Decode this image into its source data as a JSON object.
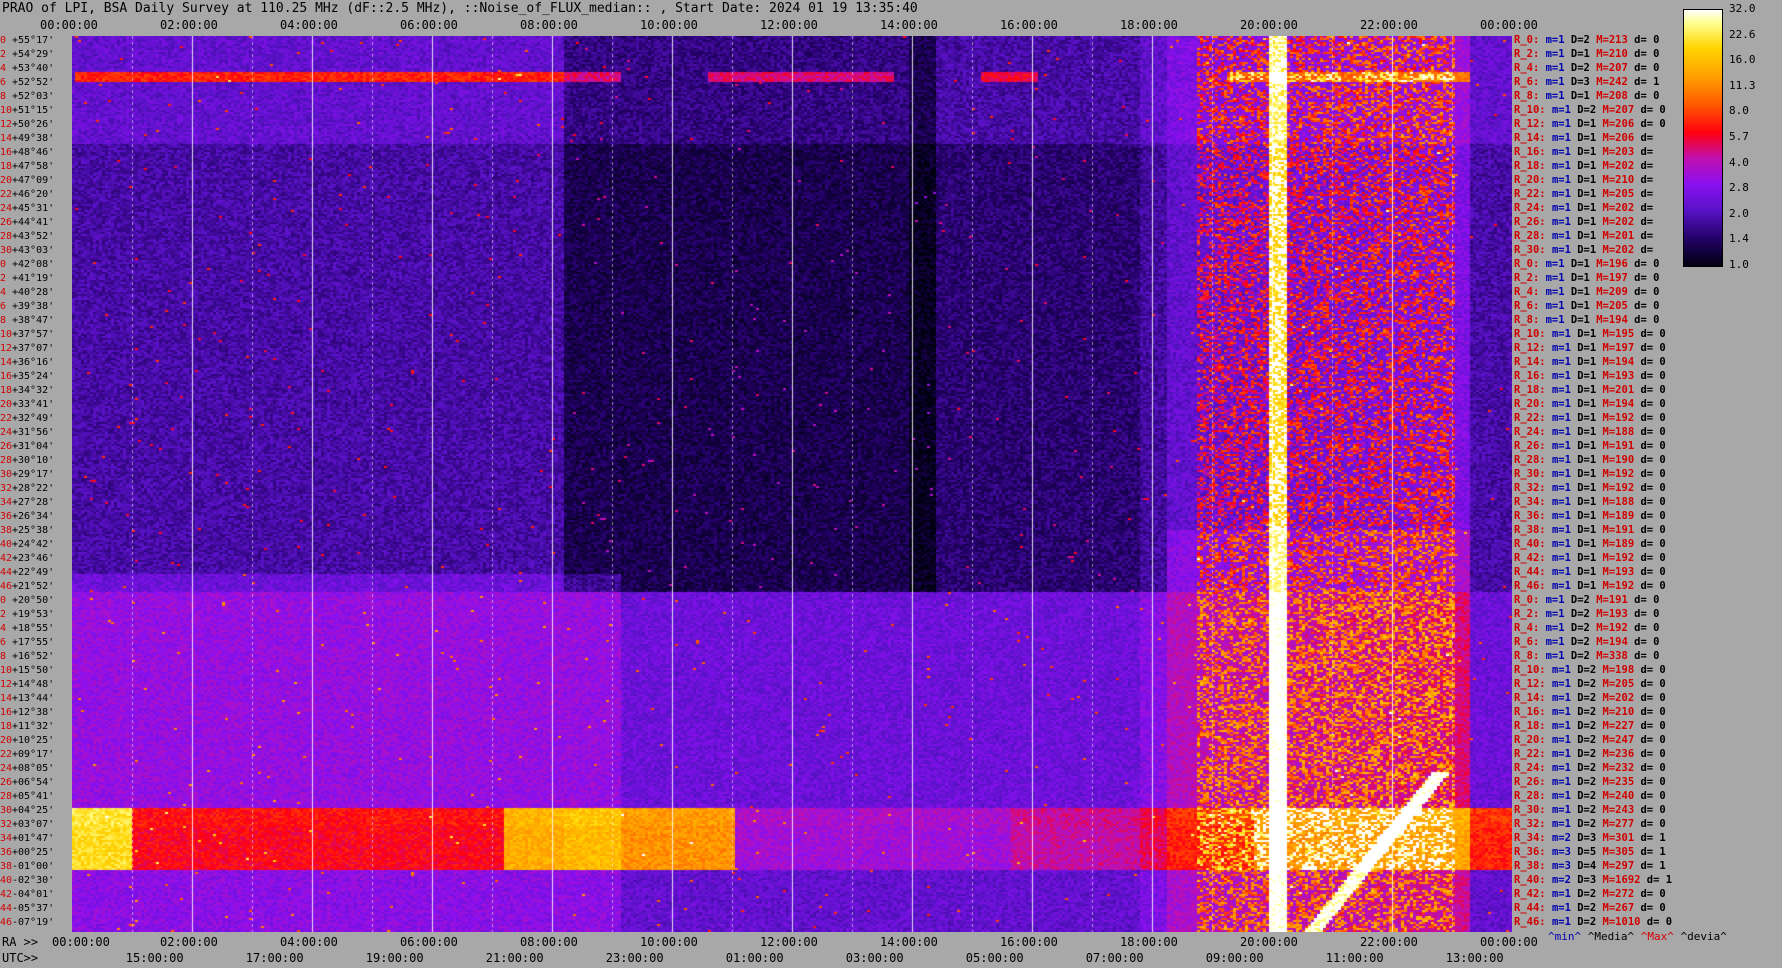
{
  "title": "PRAO of LPI, BSA Daily Survey at 110.25 MHz (dF::2.5 MHz), ::Noise_of_FLUX_median:: , Start Date: 2024 01 19 13:35:40",
  "chart_data": {
    "type": "heatmap",
    "title": "PRAO of LPI, BSA Daily Survey at 110.25 MHz (dF::2.5 MHz), ::Noise_of_FLUX_median:: , Start Date: 2024 01 19 13:35:40",
    "top_axis_ticks": [
      "00:00:00",
      "02:00:00",
      "04:00:00",
      "06:00:00",
      "08:00:00",
      "10:00:00",
      "12:00:00",
      "14:00:00",
      "16:00:00",
      "18:00:00",
      "20:00:00",
      "22:00:00",
      "00:00:00"
    ],
    "ra_axis_label": "RA >>",
    "ra_axis_ticks": [
      "00:00:00",
      "02:00:00",
      "04:00:00",
      "06:00:00",
      "08:00:00",
      "10:00:00",
      "12:00:00",
      "14:00:00",
      "16:00:00",
      "18:00:00",
      "20:00:00",
      "22:00:00",
      "00:00:00"
    ],
    "utc_axis_label": "UTC>>",
    "utc_axis_ticks": [
      "15:00:00",
      "17:00:00",
      "19:00:00",
      "21:00:00",
      "23:00:00",
      "01:00:00",
      "03:00:00",
      "05:00:00",
      "07:00:00",
      "09:00:00",
      "11:00:00",
      "13:00:00"
    ],
    "colorbar_ticks": [
      "32.0",
      "22.6",
      "16.0",
      "11.3",
      "8.0",
      "5.7",
      "4.0",
      "2.8",
      "2.0",
      "1.4",
      "1.0"
    ],
    "colorbar_scale": "log",
    "rows": [
      {
        "i": "0",
        "dec": "+55°17'"
      },
      {
        "i": "2",
        "dec": "+54°29'"
      },
      {
        "i": "4",
        "dec": "+53°40'"
      },
      {
        "i": "6",
        "dec": "+52°52'"
      },
      {
        "i": "8",
        "dec": "+52°03'"
      },
      {
        "i": "10",
        "dec": "+51°15'"
      },
      {
        "i": "12",
        "dec": "+50°26'"
      },
      {
        "i": "14",
        "dec": "+49°38'"
      },
      {
        "i": "16",
        "dec": "+48°46'"
      },
      {
        "i": "18",
        "dec": "+47°58'"
      },
      {
        "i": "20",
        "dec": "+47°09'"
      },
      {
        "i": "22",
        "dec": "+46°20'"
      },
      {
        "i": "24",
        "dec": "+45°31'"
      },
      {
        "i": "26",
        "dec": "+44°41'"
      },
      {
        "i": "28",
        "dec": "+43°52'"
      },
      {
        "i": "30",
        "dec": "+43°03'"
      },
      {
        "i": "0",
        "dec": "+42°08'"
      },
      {
        "i": "2",
        "dec": "+41°19'"
      },
      {
        "i": "4",
        "dec": "+40°28'"
      },
      {
        "i": "6",
        "dec": "+39°38'"
      },
      {
        "i": "8",
        "dec": "+38°47'"
      },
      {
        "i": "10",
        "dec": "+37°57'"
      },
      {
        "i": "12",
        "dec": "+37°07'"
      },
      {
        "i": "14",
        "dec": "+36°16'"
      },
      {
        "i": "16",
        "dec": "+35°24'"
      },
      {
        "i": "18",
        "dec": "+34°32'"
      },
      {
        "i": "20",
        "dec": "+33°41'"
      },
      {
        "i": "22",
        "dec": "+32°49'"
      },
      {
        "i": "24",
        "dec": "+31°56'"
      },
      {
        "i": "26",
        "dec": "+31°04'"
      },
      {
        "i": "28",
        "dec": "+30°10'"
      },
      {
        "i": "30",
        "dec": "+29°17'"
      },
      {
        "i": "32",
        "dec": "+28°22'"
      },
      {
        "i": "34",
        "dec": "+27°28'"
      },
      {
        "i": "36",
        "dec": "+26°34'"
      },
      {
        "i": "38",
        "dec": "+25°38'"
      },
      {
        "i": "40",
        "dec": "+24°42'"
      },
      {
        "i": "42",
        "dec": "+23°46'"
      },
      {
        "i": "44",
        "dec": "+22°49'"
      },
      {
        "i": "46",
        "dec": "+21°52'"
      },
      {
        "i": "0",
        "dec": "+20°50'"
      },
      {
        "i": "2",
        "dec": "+19°53'"
      },
      {
        "i": "4",
        "dec": "+18°55'"
      },
      {
        "i": "6",
        "dec": "+17°55'"
      },
      {
        "i": "8",
        "dec": "+16°52'"
      },
      {
        "i": "10",
        "dec": "+15°50'"
      },
      {
        "i": "12",
        "dec": "+14°48'"
      },
      {
        "i": "14",
        "dec": "+13°44'"
      },
      {
        "i": "16",
        "dec": "+12°38'"
      },
      {
        "i": "18",
        "dec": "+11°32'"
      },
      {
        "i": "20",
        "dec": "+10°25'"
      },
      {
        "i": "22",
        "dec": "+09°17'"
      },
      {
        "i": "24",
        "dec": "+08°05'"
      },
      {
        "i": "26",
        "dec": "+06°54'"
      },
      {
        "i": "28",
        "dec": "+05°41'"
      },
      {
        "i": "30",
        "dec": "+04°25'"
      },
      {
        "i": "32",
        "dec": "+03°07'"
      },
      {
        "i": "34",
        "dec": "+01°47'"
      },
      {
        "i": "36",
        "dec": "+00°25'"
      },
      {
        "i": "38",
        "dec": "-01°00'"
      },
      {
        "i": "40",
        "dec": "-02°30'"
      },
      {
        "i": "42",
        "dec": "-04°01'"
      },
      {
        "i": "44",
        "dec": "-05°37'"
      },
      {
        "i": "46",
        "dec": "-07°19'"
      }
    ],
    "stats": [
      {
        "r": "R_0:",
        "m": "m=1",
        "d": "D=2",
        "M": "M=213",
        "dv": "d= 0"
      },
      {
        "r": "R_2:",
        "m": "m=1",
        "d": "D=1",
        "M": "M=210",
        "dv": "d= 0"
      },
      {
        "r": "R_4:",
        "m": "m=1",
        "d": "D=2",
        "M": "M=207",
        "dv": "d= 0"
      },
      {
        "r": "R_6:",
        "m": "m=1",
        "d": "D=3",
        "M": "M=242",
        "dv": "d= 1"
      },
      {
        "r": "R_8:",
        "m": "m=1",
        "d": "D=1",
        "M": "M=208",
        "dv": "d= 0"
      },
      {
        "r": "R_10:",
        "m": "m=1",
        "d": "D=2",
        "M": "M=207",
        "dv": "d= 0"
      },
      {
        "r": "R_12:",
        "m": "m=1",
        "d": "D=1",
        "M": "M=206",
        "dv": "d= 0"
      },
      {
        "r": "R_14:",
        "m": "m=1",
        "d": "D=1",
        "M": "M=206",
        "dv": "d="
      },
      {
        "r": "R_16:",
        "m": "m=1",
        "d": "D=1",
        "M": "M=203",
        "dv": "d="
      },
      {
        "r": "R_18:",
        "m": "m=1",
        "d": "D=1",
        "M": "M=202",
        "dv": "d="
      },
      {
        "r": "R_20:",
        "m": "m=1",
        "d": "D=1",
        "M": "M=210",
        "dv": "d="
      },
      {
        "r": "R_22:",
        "m": "m=1",
        "d": "D=1",
        "M": "M=205",
        "dv": "d="
      },
      {
        "r": "R_24:",
        "m": "m=1",
        "d": "D=1",
        "M": "M=202",
        "dv": "d="
      },
      {
        "r": "R_26:",
        "m": "m=1",
        "d": "D=1",
        "M": "M=202",
        "dv": "d="
      },
      {
        "r": "R_28:",
        "m": "m=1",
        "d": "D=1",
        "M": "M=201",
        "dv": "d="
      },
      {
        "r": "R_30:",
        "m": "m=1",
        "d": "D=1",
        "M": "M=202",
        "dv": "d="
      },
      {
        "r": "R_0:",
        "m": "m=1",
        "d": "D=1",
        "M": "M=196",
        "dv": "d= 0"
      },
      {
        "r": "R_2:",
        "m": "m=1",
        "d": "D=1",
        "M": "M=197",
        "dv": "d= 0"
      },
      {
        "r": "R_4:",
        "m": "m=1",
        "d": "D=1",
        "M": "M=209",
        "dv": "d= 0"
      },
      {
        "r": "R_6:",
        "m": "m=1",
        "d": "D=1",
        "M": "M=205",
        "dv": "d= 0"
      },
      {
        "r": "R_8:",
        "m": "m=1",
        "d": "D=1",
        "M": "M=194",
        "dv": "d= 0"
      },
      {
        "r": "R_10:",
        "m": "m=1",
        "d": "D=1",
        "M": "M=195",
        "dv": "d= 0"
      },
      {
        "r": "R_12:",
        "m": "m=1",
        "d": "D=1",
        "M": "M=197",
        "dv": "d= 0"
      },
      {
        "r": "R_14:",
        "m": "m=1",
        "d": "D=1",
        "M": "M=194",
        "dv": "d= 0"
      },
      {
        "r": "R_16:",
        "m": "m=1",
        "d": "D=1",
        "M": "M=193",
        "dv": "d= 0"
      },
      {
        "r": "R_18:",
        "m": "m=1",
        "d": "D=1",
        "M": "M=201",
        "dv": "d= 0"
      },
      {
        "r": "R_20:",
        "m": "m=1",
        "d": "D=1",
        "M": "M=194",
        "dv": "d= 0"
      },
      {
        "r": "R_22:",
        "m": "m=1",
        "d": "D=1",
        "M": "M=192",
        "dv": "d= 0"
      },
      {
        "r": "R_24:",
        "m": "m=1",
        "d": "D=1",
        "M": "M=188",
        "dv": "d= 0"
      },
      {
        "r": "R_26:",
        "m": "m=1",
        "d": "D=1",
        "M": "M=191",
        "dv": "d= 0"
      },
      {
        "r": "R_28:",
        "m": "m=1",
        "d": "D=1",
        "M": "M=190",
        "dv": "d= 0"
      },
      {
        "r": "R_30:",
        "m": "m=1",
        "d": "D=1",
        "M": "M=192",
        "dv": "d= 0"
      },
      {
        "r": "R_32:",
        "m": "m=1",
        "d": "D=1",
        "M": "M=192",
        "dv": "d= 0"
      },
      {
        "r": "R_34:",
        "m": "m=1",
        "d": "D=1",
        "M": "M=188",
        "dv": "d= 0"
      },
      {
        "r": "R_36:",
        "m": "m=1",
        "d": "D=1",
        "M": "M=189",
        "dv": "d= 0"
      },
      {
        "r": "R_38:",
        "m": "m=1",
        "d": "D=1",
        "M": "M=191",
        "dv": "d= 0"
      },
      {
        "r": "R_40:",
        "m": "m=1",
        "d": "D=1",
        "M": "M=189",
        "dv": "d= 0"
      },
      {
        "r": "R_42:",
        "m": "m=1",
        "d": "D=1",
        "M": "M=192",
        "dv": "d= 0"
      },
      {
        "r": "R_44:",
        "m": "m=1",
        "d": "D=1",
        "M": "M=193",
        "dv": "d= 0"
      },
      {
        "r": "R_46:",
        "m": "m=1",
        "d": "D=1",
        "M": "M=192",
        "dv": "d= 0"
      },
      {
        "r": "R_0:",
        "m": "m=1",
        "d": "D=2",
        "M": "M=191",
        "dv": "d= 0"
      },
      {
        "r": "R_2:",
        "m": "m=1",
        "d": "D=2",
        "M": "M=193",
        "dv": "d= 0"
      },
      {
        "r": "R_4:",
        "m": "m=1",
        "d": "D=2",
        "M": "M=192",
        "dv": "d= 0"
      },
      {
        "r": "R_6:",
        "m": "m=1",
        "d": "D=2",
        "M": "M=194",
        "dv": "d= 0"
      },
      {
        "r": "R_8:",
        "m": "m=1",
        "d": "D=2",
        "M": "M=338",
        "dv": "d= 0"
      },
      {
        "r": "R_10:",
        "m": "m=1",
        "d": "D=2",
        "M": "M=198",
        "dv": "d= 0"
      },
      {
        "r": "R_12:",
        "m": "m=1",
        "d": "D=2",
        "M": "M=205",
        "dv": "d= 0"
      },
      {
        "r": "R_14:",
        "m": "m=1",
        "d": "D=2",
        "M": "M=202",
        "dv": "d= 0"
      },
      {
        "r": "R_16:",
        "m": "m=1",
        "d": "D=2",
        "M": "M=210",
        "dv": "d= 0"
      },
      {
        "r": "R_18:",
        "m": "m=1",
        "d": "D=2",
        "M": "M=227",
        "dv": "d= 0"
      },
      {
        "r": "R_20:",
        "m": "m=1",
        "d": "D=2",
        "M": "M=247",
        "dv": "d= 0"
      },
      {
        "r": "R_22:",
        "m": "m=1",
        "d": "D=2",
        "M": "M=236",
        "dv": "d= 0"
      },
      {
        "r": "R_24:",
        "m": "m=1",
        "d": "D=2",
        "M": "M=232",
        "dv": "d= 0"
      },
      {
        "r": "R_26:",
        "m": "m=1",
        "d": "D=2",
        "M": "M=235",
        "dv": "d= 0"
      },
      {
        "r": "R_28:",
        "m": "m=1",
        "d": "D=2",
        "M": "M=240",
        "dv": "d= 0"
      },
      {
        "r": "R_30:",
        "m": "m=1",
        "d": "D=2",
        "M": "M=243",
        "dv": "d= 0"
      },
      {
        "r": "R_32:",
        "m": "m=1",
        "d": "D=2",
        "M": "M=277",
        "dv": "d= 0"
      },
      {
        "r": "R_34:",
        "m": "m=2",
        "d": "D=3",
        "M": "M=301",
        "dv": "d= 1"
      },
      {
        "r": "R_36:",
        "m": "m=3",
        "d": "D=5",
        "M": "M=305",
        "dv": "d= 1"
      },
      {
        "r": "R_38:",
        "m": "m=3",
        "d": "D=4",
        "M": "M=297",
        "dv": "d= 1"
      },
      {
        "r": "R_40:",
        "m": "m=2",
        "d": "D=3",
        "M": "M=1692",
        "dv": "d= 1"
      },
      {
        "r": "R_42:",
        "m": "m=1",
        "d": "D=2",
        "M": "M=272",
        "dv": "d= 0"
      },
      {
        "r": "R_44:",
        "m": "m=1",
        "d": "D=2",
        "M": "M=267",
        "dv": "d= 0"
      },
      {
        "r": "R_46:",
        "m": "m=1",
        "d": "D=2",
        "M": "M=1010",
        "dv": "d= 0"
      }
    ],
    "legend": {
      "min": "^min^",
      "median": "^Media^",
      "max": "^Max^",
      "devia": "^devia^"
    }
  },
  "colors": {
    "background": "#a8a8a8",
    "row_index": "#d00000",
    "stat_min": "#0000b0",
    "stat_max": "#d00000"
  }
}
